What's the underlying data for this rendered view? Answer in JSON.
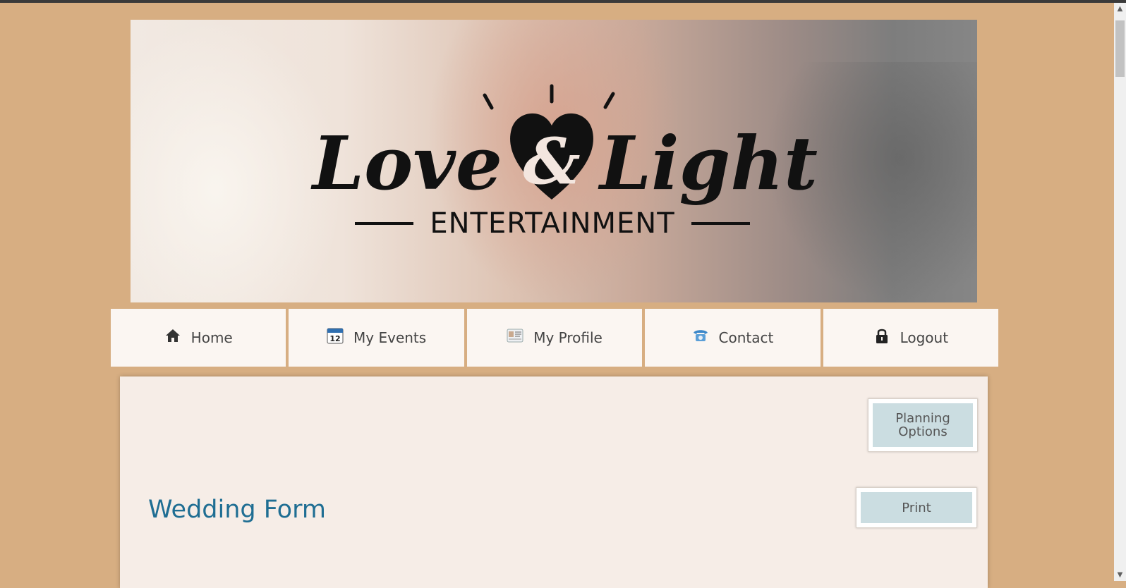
{
  "brand": {
    "logo_script_line1": "Love",
    "logo_ampersand": "&",
    "logo_script_line2": "Light",
    "logo_subtitle": "ENTERTAINMENT"
  },
  "nav": {
    "items": [
      {
        "label": "Home",
        "icon": "home-icon"
      },
      {
        "label": "My Events",
        "icon": "calendar-icon"
      },
      {
        "label": "My Profile",
        "icon": "profile-card-icon"
      },
      {
        "label": "Contact",
        "icon": "telephone-icon"
      },
      {
        "label": "Logout",
        "icon": "lock-icon"
      }
    ],
    "calendar_day": "12"
  },
  "main": {
    "planning_button": "Planning Options",
    "print_button": "Print",
    "title": "Wedding Form"
  },
  "colors": {
    "page_background": "#d7ae82",
    "nav_background": "#fbf6f2",
    "panel_background": "#f6ede7",
    "button_background": "#cbdde1",
    "title_color": "#1f6e93"
  }
}
